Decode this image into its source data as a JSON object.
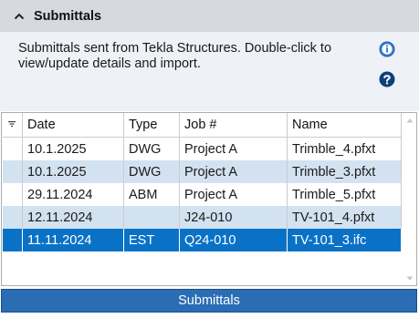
{
  "header": {
    "title": "Submittals"
  },
  "description": {
    "text": "Submittals sent from Tekla Structures.  Double-click to view/update details and import."
  },
  "table": {
    "columns": [
      "Date",
      "Type",
      "Job #",
      "Name"
    ],
    "rows": [
      {
        "date": "10.1.2025",
        "type": "DWG",
        "job": "Project A",
        "name": "Trimble_4.pfxt"
      },
      {
        "date": "10.1.2025",
        "type": "DWG",
        "job": "Project A",
        "name": "Trimble_3.pfxt"
      },
      {
        "date": "29.11.2024",
        "type": "ABM",
        "job": "Project A",
        "name": "Trimble_5.pfxt"
      },
      {
        "date": "12.11.2024",
        "type": "",
        "job": "J24-010",
        "name": "TV-101_4.pfxt"
      },
      {
        "date": "11.11.2024",
        "type": "EST",
        "job": "Q24-010",
        "name": "TV-101_3.ifc"
      }
    ],
    "selected_row": 4
  },
  "footer": {
    "button_label": "Submittals"
  },
  "colors": {
    "selected_row": "#0a72c6",
    "alt_row": "#d3e2f0",
    "footer": "#2a6db5",
    "header_bg": "#d6dae0"
  },
  "icons": {
    "collapse": "chevron-up-icon",
    "info": "info-icon",
    "help": "help-icon",
    "filter": "filter-icon"
  }
}
